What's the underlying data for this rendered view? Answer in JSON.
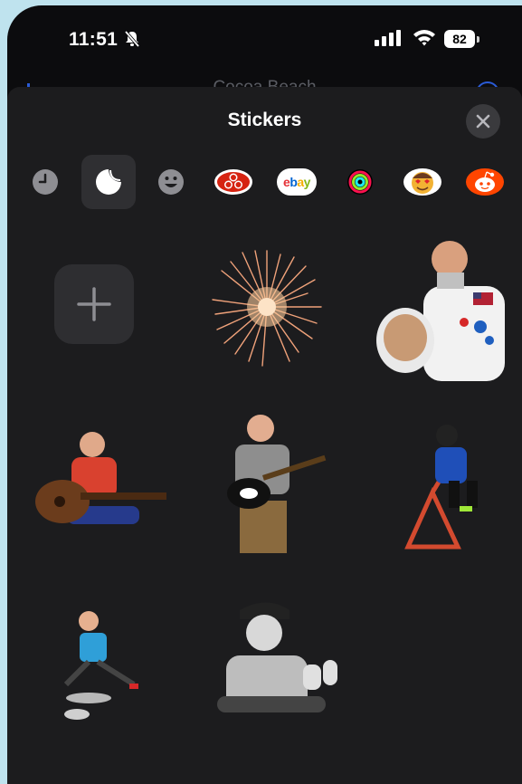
{
  "status_bar": {
    "time": "11:51",
    "battery": "82"
  },
  "background_title": "Cocoa Beach",
  "sheet": {
    "title": "Stickers"
  },
  "tabs": [
    {
      "name": "recents",
      "icon": "clock-icon"
    },
    {
      "name": "stickers",
      "icon": "sticker-peel-icon",
      "active": true
    },
    {
      "name": "memoji",
      "icon": "smiley-icon"
    },
    {
      "name": "state-farm",
      "icon": "state-farm-logo-icon"
    },
    {
      "name": "ebay",
      "icon": "ebay-logo-icon",
      "label": "ebay"
    },
    {
      "name": "activity",
      "icon": "activity-rings-icon"
    },
    {
      "name": "emoji-app",
      "icon": "emoji-face-icon"
    },
    {
      "name": "reddit",
      "icon": "reddit-logo-icon"
    }
  ],
  "stickers": [
    {
      "type": "add",
      "icon": "plus-icon"
    },
    {
      "type": "sticker",
      "subject": "fireworks-burst"
    },
    {
      "type": "sticker",
      "subject": "astronaut-man"
    },
    {
      "type": "sticker",
      "subject": "man-acoustic-guitar"
    },
    {
      "type": "sticker",
      "subject": "man-electric-guitar"
    },
    {
      "type": "sticker",
      "subject": "child-climbing-frame"
    },
    {
      "type": "sticker",
      "subject": "child-on-scooter"
    },
    {
      "type": "sticker",
      "subject": "man-thumbs-up"
    }
  ],
  "colors": {
    "sheet_bg": "#1c1c1e",
    "tab_active_bg": "#2f2f32",
    "close_bg": "#3a3a3d",
    "add_bg": "#2e2e31"
  }
}
